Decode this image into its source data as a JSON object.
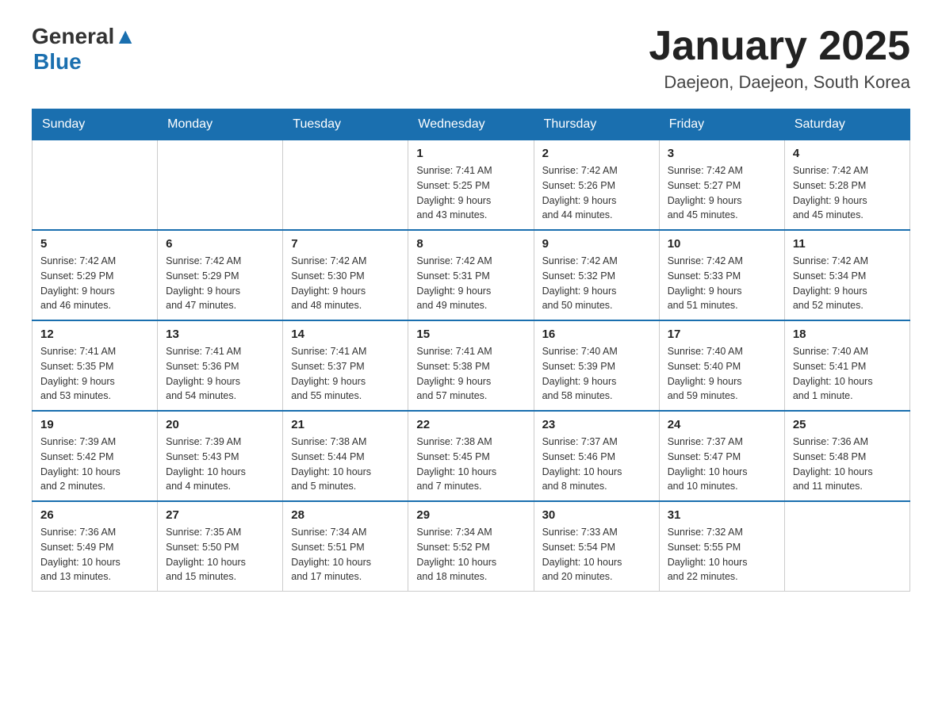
{
  "header": {
    "logo_main": "General",
    "logo_accent": "Blue",
    "title": "January 2025",
    "subtitle": "Daejeon, Daejeon, South Korea"
  },
  "days_of_week": [
    "Sunday",
    "Monday",
    "Tuesday",
    "Wednesday",
    "Thursday",
    "Friday",
    "Saturday"
  ],
  "weeks": [
    [
      {
        "day": "",
        "info": ""
      },
      {
        "day": "",
        "info": ""
      },
      {
        "day": "",
        "info": ""
      },
      {
        "day": "1",
        "info": "Sunrise: 7:41 AM\nSunset: 5:25 PM\nDaylight: 9 hours\nand 43 minutes."
      },
      {
        "day": "2",
        "info": "Sunrise: 7:42 AM\nSunset: 5:26 PM\nDaylight: 9 hours\nand 44 minutes."
      },
      {
        "day": "3",
        "info": "Sunrise: 7:42 AM\nSunset: 5:27 PM\nDaylight: 9 hours\nand 45 minutes."
      },
      {
        "day": "4",
        "info": "Sunrise: 7:42 AM\nSunset: 5:28 PM\nDaylight: 9 hours\nand 45 minutes."
      }
    ],
    [
      {
        "day": "5",
        "info": "Sunrise: 7:42 AM\nSunset: 5:29 PM\nDaylight: 9 hours\nand 46 minutes."
      },
      {
        "day": "6",
        "info": "Sunrise: 7:42 AM\nSunset: 5:29 PM\nDaylight: 9 hours\nand 47 minutes."
      },
      {
        "day": "7",
        "info": "Sunrise: 7:42 AM\nSunset: 5:30 PM\nDaylight: 9 hours\nand 48 minutes."
      },
      {
        "day": "8",
        "info": "Sunrise: 7:42 AM\nSunset: 5:31 PM\nDaylight: 9 hours\nand 49 minutes."
      },
      {
        "day": "9",
        "info": "Sunrise: 7:42 AM\nSunset: 5:32 PM\nDaylight: 9 hours\nand 50 minutes."
      },
      {
        "day": "10",
        "info": "Sunrise: 7:42 AM\nSunset: 5:33 PM\nDaylight: 9 hours\nand 51 minutes."
      },
      {
        "day": "11",
        "info": "Sunrise: 7:42 AM\nSunset: 5:34 PM\nDaylight: 9 hours\nand 52 minutes."
      }
    ],
    [
      {
        "day": "12",
        "info": "Sunrise: 7:41 AM\nSunset: 5:35 PM\nDaylight: 9 hours\nand 53 minutes."
      },
      {
        "day": "13",
        "info": "Sunrise: 7:41 AM\nSunset: 5:36 PM\nDaylight: 9 hours\nand 54 minutes."
      },
      {
        "day": "14",
        "info": "Sunrise: 7:41 AM\nSunset: 5:37 PM\nDaylight: 9 hours\nand 55 minutes."
      },
      {
        "day": "15",
        "info": "Sunrise: 7:41 AM\nSunset: 5:38 PM\nDaylight: 9 hours\nand 57 minutes."
      },
      {
        "day": "16",
        "info": "Sunrise: 7:40 AM\nSunset: 5:39 PM\nDaylight: 9 hours\nand 58 minutes."
      },
      {
        "day": "17",
        "info": "Sunrise: 7:40 AM\nSunset: 5:40 PM\nDaylight: 9 hours\nand 59 minutes."
      },
      {
        "day": "18",
        "info": "Sunrise: 7:40 AM\nSunset: 5:41 PM\nDaylight: 10 hours\nand 1 minute."
      }
    ],
    [
      {
        "day": "19",
        "info": "Sunrise: 7:39 AM\nSunset: 5:42 PM\nDaylight: 10 hours\nand 2 minutes."
      },
      {
        "day": "20",
        "info": "Sunrise: 7:39 AM\nSunset: 5:43 PM\nDaylight: 10 hours\nand 4 minutes."
      },
      {
        "day": "21",
        "info": "Sunrise: 7:38 AM\nSunset: 5:44 PM\nDaylight: 10 hours\nand 5 minutes."
      },
      {
        "day": "22",
        "info": "Sunrise: 7:38 AM\nSunset: 5:45 PM\nDaylight: 10 hours\nand 7 minutes."
      },
      {
        "day": "23",
        "info": "Sunrise: 7:37 AM\nSunset: 5:46 PM\nDaylight: 10 hours\nand 8 minutes."
      },
      {
        "day": "24",
        "info": "Sunrise: 7:37 AM\nSunset: 5:47 PM\nDaylight: 10 hours\nand 10 minutes."
      },
      {
        "day": "25",
        "info": "Sunrise: 7:36 AM\nSunset: 5:48 PM\nDaylight: 10 hours\nand 11 minutes."
      }
    ],
    [
      {
        "day": "26",
        "info": "Sunrise: 7:36 AM\nSunset: 5:49 PM\nDaylight: 10 hours\nand 13 minutes."
      },
      {
        "day": "27",
        "info": "Sunrise: 7:35 AM\nSunset: 5:50 PM\nDaylight: 10 hours\nand 15 minutes."
      },
      {
        "day": "28",
        "info": "Sunrise: 7:34 AM\nSunset: 5:51 PM\nDaylight: 10 hours\nand 17 minutes."
      },
      {
        "day": "29",
        "info": "Sunrise: 7:34 AM\nSunset: 5:52 PM\nDaylight: 10 hours\nand 18 minutes."
      },
      {
        "day": "30",
        "info": "Sunrise: 7:33 AM\nSunset: 5:54 PM\nDaylight: 10 hours\nand 20 minutes."
      },
      {
        "day": "31",
        "info": "Sunrise: 7:32 AM\nSunset: 5:55 PM\nDaylight: 10 hours\nand 22 minutes."
      },
      {
        "day": "",
        "info": ""
      }
    ]
  ]
}
